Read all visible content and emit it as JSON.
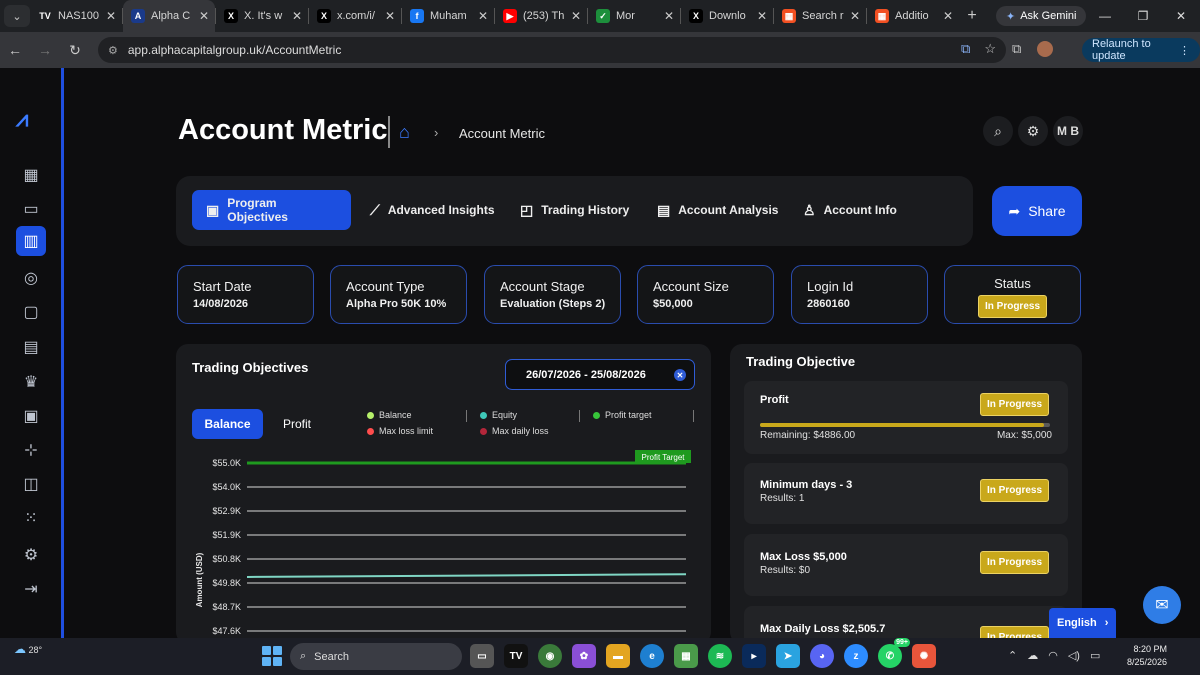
{
  "browser": {
    "tabs": [
      {
        "title": "NAS100",
        "fav": "TV",
        "color": "#1f2124",
        "fg": "#fff",
        "active": false
      },
      {
        "title": "Alpha C",
        "fav": "A",
        "color": "#1a3a8a",
        "fg": "#fff",
        "active": true
      },
      {
        "title": "X. It's w",
        "fav": "X",
        "color": "#000",
        "fg": "#fff",
        "active": false
      },
      {
        "title": "x.com/i/",
        "fav": "X",
        "color": "#000",
        "fg": "#fff",
        "active": false
      },
      {
        "title": "Muham",
        "fav": "f",
        "color": "#1877f2",
        "fg": "#fff",
        "active": false
      },
      {
        "title": "(253) Th",
        "fav": "▶",
        "color": "#ff0000",
        "fg": "#fff",
        "active": false
      },
      {
        "title": "Mor",
        "fav": "✓",
        "color": "#1d8f3c",
        "fg": "#fff",
        "active": false
      },
      {
        "title": "Downlo",
        "fav": "X",
        "color": "#000",
        "fg": "#fff",
        "active": false
      },
      {
        "title": "Search r",
        "fav": "▦",
        "color": "#f25022",
        "fg": "#fff",
        "active": false
      },
      {
        "title": "Additio",
        "fav": "▦",
        "color": "#f25022",
        "fg": "#fff",
        "active": false
      }
    ],
    "gemini_label": "Ask Gemini",
    "url": "app.alphacapitalgroup.uk/AccountMetric",
    "relaunch_label": "Relaunch to update"
  },
  "header": {
    "title": "Account Metric",
    "breadcrumb": "Account Metric",
    "avatar_initials": "M B"
  },
  "program_tabs": [
    {
      "label": "Program Objectives",
      "icon": "▣",
      "active": true
    },
    {
      "label": "Advanced Insights",
      "icon": "⟋",
      "active": false
    },
    {
      "label": "Trading History",
      "icon": "◰",
      "active": false
    },
    {
      "label": "Account Analysis",
      "icon": "▤",
      "active": false
    },
    {
      "label": "Account Info",
      "icon": "♙",
      "active": false
    }
  ],
  "share_label": "Share",
  "cards": [
    {
      "label": "Start Date",
      "value": "14/08/2026"
    },
    {
      "label": "Account Type",
      "value": "Alpha Pro 50K 10%"
    },
    {
      "label": "Account Stage",
      "value": "Evaluation (Steps 2)"
    },
    {
      "label": "Account Size",
      "value": "$50,000"
    },
    {
      "label": "Login Id",
      "value": "2860160"
    }
  ],
  "status_card": {
    "label": "Status",
    "value": "In Progress"
  },
  "trading_objectives": {
    "title": "Trading Objectives",
    "date_range": "26/07/2026 - 25/08/2026",
    "segments": [
      "Balance",
      "Profit"
    ],
    "legend": [
      {
        "label": "Balance",
        "color": "#b6f06a"
      },
      {
        "label": "Equity",
        "color": "#3fc9b9"
      },
      {
        "label": "Profit target",
        "color": "#37c53a"
      },
      {
        "label": "Max loss limit",
        "color": "#ff4d4d"
      },
      {
        "label": "Max daily loss",
        "color": "#b3263a"
      }
    ]
  },
  "chart_data": {
    "type": "line",
    "ylabel": "Amount (USD)",
    "y_ticks": [
      "$55.0K",
      "$54.0K",
      "$52.9K",
      "$51.9K",
      "$50.8K",
      "$49.8K",
      "$48.7K",
      "$47.6K"
    ],
    "ylim": [
      47600,
      55000
    ],
    "profit_target": 55000,
    "profit_target_label": "Profit Target",
    "series": [
      {
        "name": "Equity",
        "x": [
          0,
          1
        ],
        "values": [
          49980,
          50100
        ],
        "color": "#7fd6c4"
      }
    ]
  },
  "trading_objective_panel": {
    "title": "Trading Objective",
    "rows": [
      {
        "name": "Profit",
        "status": "In Progress",
        "remaining": "Remaining: $4886.00",
        "max": "Max: $5,000",
        "progress": 0.98
      },
      {
        "name": "Minimum days - 3",
        "result": "Results: 1",
        "status": "In Progress"
      },
      {
        "name": "Max Loss $5,000",
        "result": "Results: $0",
        "status": "In Progress"
      },
      {
        "name": "Max Daily Loss $2,505.7",
        "result": "",
        "status": "In Progress"
      }
    ]
  },
  "language_label": "English",
  "taskbar": {
    "weather": "28°",
    "search_placeholder": "Search",
    "time": "8:20 PM",
    "date": "8/25/2026",
    "whatsapp_badge": "99+"
  }
}
